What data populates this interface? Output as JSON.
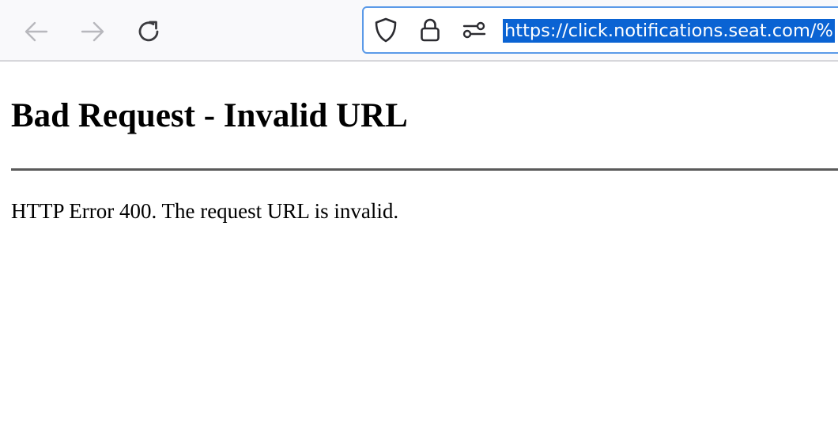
{
  "browser": {
    "url": "https://click.notifications.seat.com/%",
    "url_selected": true,
    "icons": {
      "back": "arrow-left-icon",
      "forward": "arrow-right-icon",
      "reload": "reload-icon",
      "tracking": "shield-icon",
      "security": "lock-icon",
      "permissions": "permissions-icon"
    },
    "colors": {
      "url_highlight": "#0a63d3",
      "focus_border": "#5b9ae8"
    }
  },
  "page": {
    "heading": "Bad Request - Invalid URL",
    "message": "HTTP Error 400. The request URL is invalid."
  }
}
